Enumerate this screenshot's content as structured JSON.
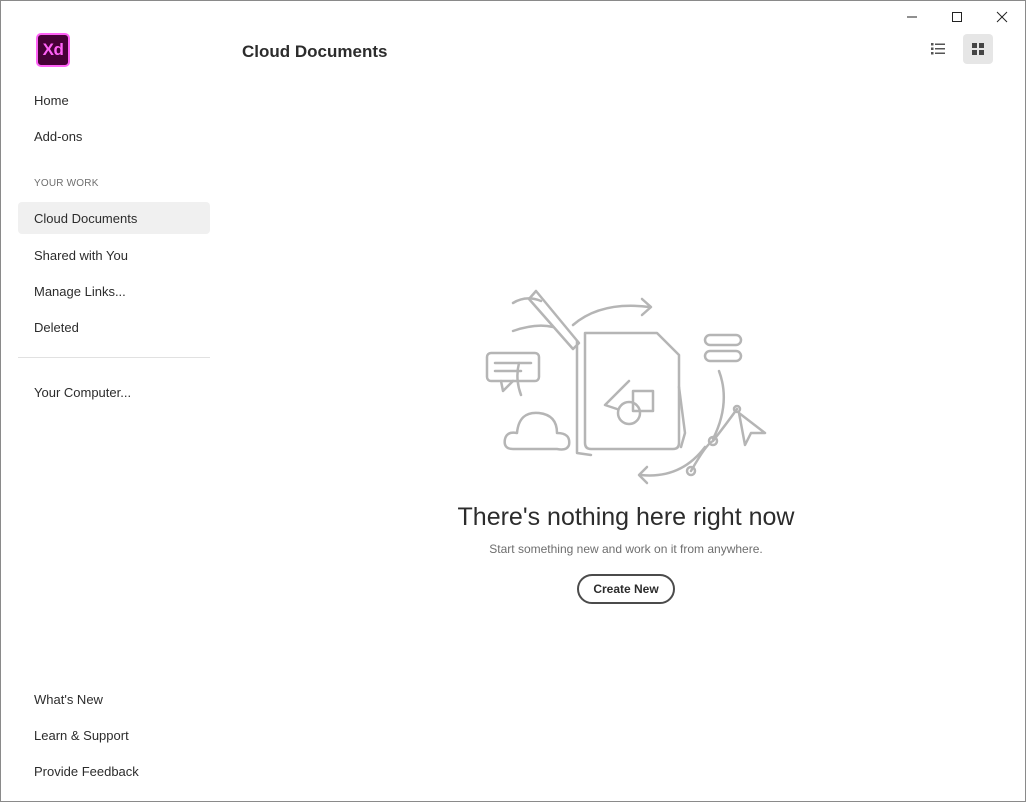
{
  "app": {
    "logo_text": "Xd",
    "brand_color": "#ff61f6",
    "brand_bg": "#470137"
  },
  "window_controls": [
    "minimize-icon",
    "maximize-icon",
    "close-icon"
  ],
  "sidebar": {
    "top_items": [
      {
        "label": "Home"
      },
      {
        "label": "Add-ons"
      }
    ],
    "section_label": "YOUR WORK",
    "work_items": [
      {
        "label": "Cloud Documents",
        "active": true
      },
      {
        "label": "Shared with You"
      },
      {
        "label": "Manage Links..."
      },
      {
        "label": "Deleted"
      }
    ],
    "computer_item": "Your Computer...",
    "bottom_items": [
      {
        "label": "What's New"
      },
      {
        "label": "Learn & Support"
      },
      {
        "label": "Provide Feedback"
      }
    ]
  },
  "header": {
    "title": "Cloud Documents",
    "view_modes": [
      "list-view-icon",
      "grid-view-icon"
    ],
    "active_view": "grid"
  },
  "empty_state": {
    "title": "There's nothing here right now",
    "subtitle": "Start something new and work on it from anywhere.",
    "button_label": "Create New"
  }
}
